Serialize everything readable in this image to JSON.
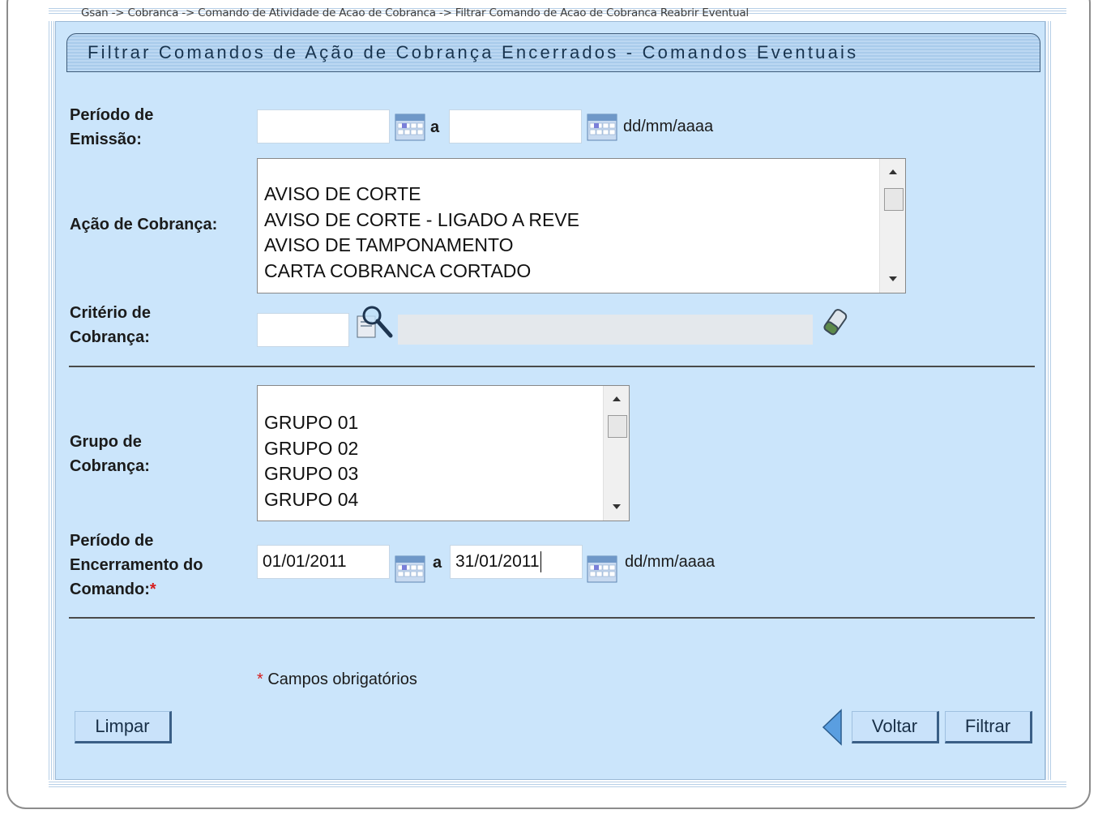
{
  "breadcrumb": "Gsan -> Cobranca -> Comando de Atividade de Acao de Cobranca -> Filtrar Comando de Acao de Cobranca Reabrir Eventual",
  "title": "Filtrar Comandos de Ação de Cobrança Encerrados - Comandos Eventuais",
  "periodo_emissao": {
    "label_line1": "Período de",
    "label_line2": "Emissão:",
    "start_value": "",
    "end_value": "",
    "separator": "a",
    "format_hint": "dd/mm/aaaa"
  },
  "acao_cobranca": {
    "label": "Ação de Cobrança:",
    "options": [
      "",
      "AVISO DE CORTE",
      "AVISO DE CORTE - LIGADO A REVE",
      "AVISO DE TAMPONAMENTO",
      "CARTA COBRANCA CORTADO"
    ]
  },
  "criterio_cobranca": {
    "label_line1": "Critério de",
    "label_line2": "Cobrança:",
    "code_value": "",
    "description_value": ""
  },
  "grupo_cobranca": {
    "label_line1": "Grupo de",
    "label_line2": "Cobrança:",
    "options": [
      "",
      "GRUPO 01",
      "GRUPO 02",
      "GRUPO 03",
      "GRUPO 04"
    ]
  },
  "periodo_encerramento": {
    "label_line1": "Período de",
    "label_line2": "Encerramento do",
    "label_line3": "Comando:",
    "required_mark": "*",
    "start_value": "01/01/2011",
    "end_value": "31/01/2011",
    "separator": "a",
    "format_hint": "dd/mm/aaaa"
  },
  "required_note": {
    "mark": "*",
    "text": "Campos obrigatórios"
  },
  "buttons": {
    "limpar": "Limpar",
    "voltar": "Voltar",
    "filtrar": "Filtrar"
  },
  "colors": {
    "panel_bg": "#cbe5fb",
    "required": "#d61d1d",
    "button_bg": "#c9e2fa"
  }
}
